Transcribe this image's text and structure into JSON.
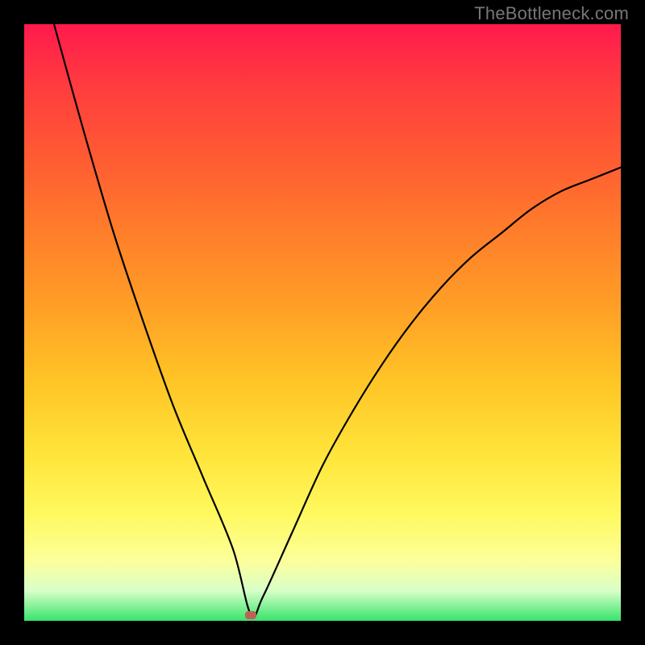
{
  "watermark": "TheBottleneck.com",
  "colors": {
    "frame_bg": "#000000",
    "curve": "#000000",
    "marker": "#bd6158",
    "gradient_stops": [
      "#ff1a4d",
      "#ff3b3f",
      "#ff5a33",
      "#ff7e2a",
      "#ffa126",
      "#ffc526",
      "#ffe43a",
      "#fff95e",
      "#fcff9c",
      "#d8ffc8",
      "#37e36b"
    ]
  },
  "chart_data": {
    "type": "line",
    "title": "",
    "xlabel": "",
    "ylabel": "",
    "xlim": [
      0,
      100
    ],
    "ylim": [
      0,
      100
    ],
    "grid": false,
    "series": [
      {
        "name": "bottleneck-curve",
        "x": [
          5,
          10,
          15,
          20,
          25,
          30,
          35,
          38,
          40,
          45,
          50,
          55,
          60,
          65,
          70,
          75,
          80,
          85,
          90,
          95,
          100
        ],
        "y": [
          100,
          82,
          65,
          50,
          36,
          24,
          12,
          1,
          4,
          15,
          26,
          35,
          43,
          50,
          56,
          61,
          65,
          69,
          72,
          74,
          76
        ]
      }
    ],
    "annotations": [
      {
        "name": "minimum-marker",
        "x": 38,
        "y": 1
      }
    ]
  }
}
